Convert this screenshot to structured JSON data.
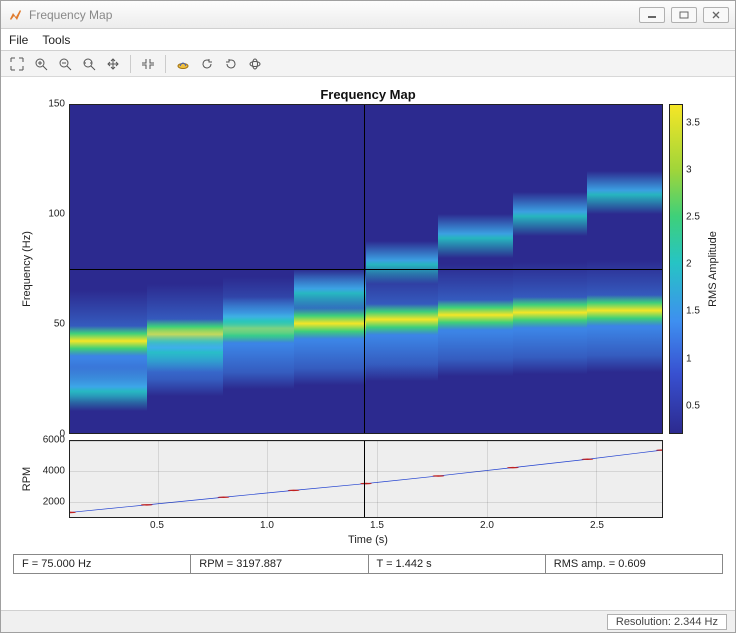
{
  "window": {
    "title": "Frequency Map"
  },
  "menubar": {
    "file": "File",
    "tools": "Tools"
  },
  "toolbar_icons": {
    "zoom_full": "zoom-full",
    "zoom_in": "zoom-in",
    "zoom_out": "zoom-out",
    "data_cursor": "data-cursor",
    "pan": "pan",
    "collapse": "collapse",
    "view3d": "view3d",
    "rotate_ccw": "rotate-ccw",
    "rotate_cw": "rotate-cw",
    "brush": "brush"
  },
  "readout": {
    "f": "F = 75.000 Hz",
    "rpm": "RPM = 3197.887",
    "t": "T = 1.442 s",
    "rms": "RMS amp. = 0.609"
  },
  "statusbar": {
    "resolution": "Resolution: 2.344 Hz"
  },
  "chart_data": {
    "main": {
      "type": "heatmap",
      "title": "Frequency Map",
      "xlabel": "Time (s)",
      "ylabel": "Frequency (Hz)",
      "xlim": [
        0.1,
        2.8
      ],
      "ylim": [
        0,
        150
      ],
      "x_ticks": [
        0.5,
        1.0,
        1.5,
        2.0,
        2.5
      ],
      "y_ticks": [
        0,
        50,
        100,
        150
      ],
      "colorbar": {
        "label": "RMS Amplitude",
        "ticks": [
          0.5,
          1,
          1.5,
          2,
          2.5,
          3,
          3.5
        ],
        "range": [
          0.2,
          3.7
        ]
      },
      "crosshair": {
        "t": 1.442,
        "f": 75.0
      },
      "segments": [
        {
          "t_start": 0.1,
          "t_end": 0.45,
          "order1_hz": 42,
          "order2_hz": 20
        },
        {
          "t_start": 0.45,
          "t_end": 0.8,
          "order1_hz": 45,
          "order2_hz": 38
        },
        {
          "t_start": 0.8,
          "t_end": 1.12,
          "order1_hz": 48,
          "order2_hz": 52
        },
        {
          "t_start": 1.12,
          "t_end": 1.45,
          "order1_hz": 50,
          "order2_hz": 65
        },
        {
          "t_start": 1.45,
          "t_end": 1.78,
          "order1_hz": 52,
          "order2_hz": 78
        },
        {
          "t_start": 1.78,
          "t_end": 2.12,
          "order1_hz": 54,
          "order2_hz": 90
        },
        {
          "t_start": 2.12,
          "t_end": 2.46,
          "order1_hz": 55,
          "order2_hz": 100
        },
        {
          "t_start": 2.46,
          "t_end": 2.8,
          "order1_hz": 56,
          "order2_hz": 110
        }
      ]
    },
    "rpm": {
      "type": "line",
      "ylabel": "RPM",
      "ylim": [
        1000,
        6000
      ],
      "y_ticks": [
        2000,
        4000,
        6000
      ],
      "x": [
        0.1,
        0.45,
        0.8,
        1.12,
        1.45,
        1.78,
        2.12,
        2.46,
        2.8
      ],
      "y": [
        1300,
        1800,
        2300,
        2750,
        3200,
        3700,
        4250,
        4800,
        5400
      ]
    }
  }
}
